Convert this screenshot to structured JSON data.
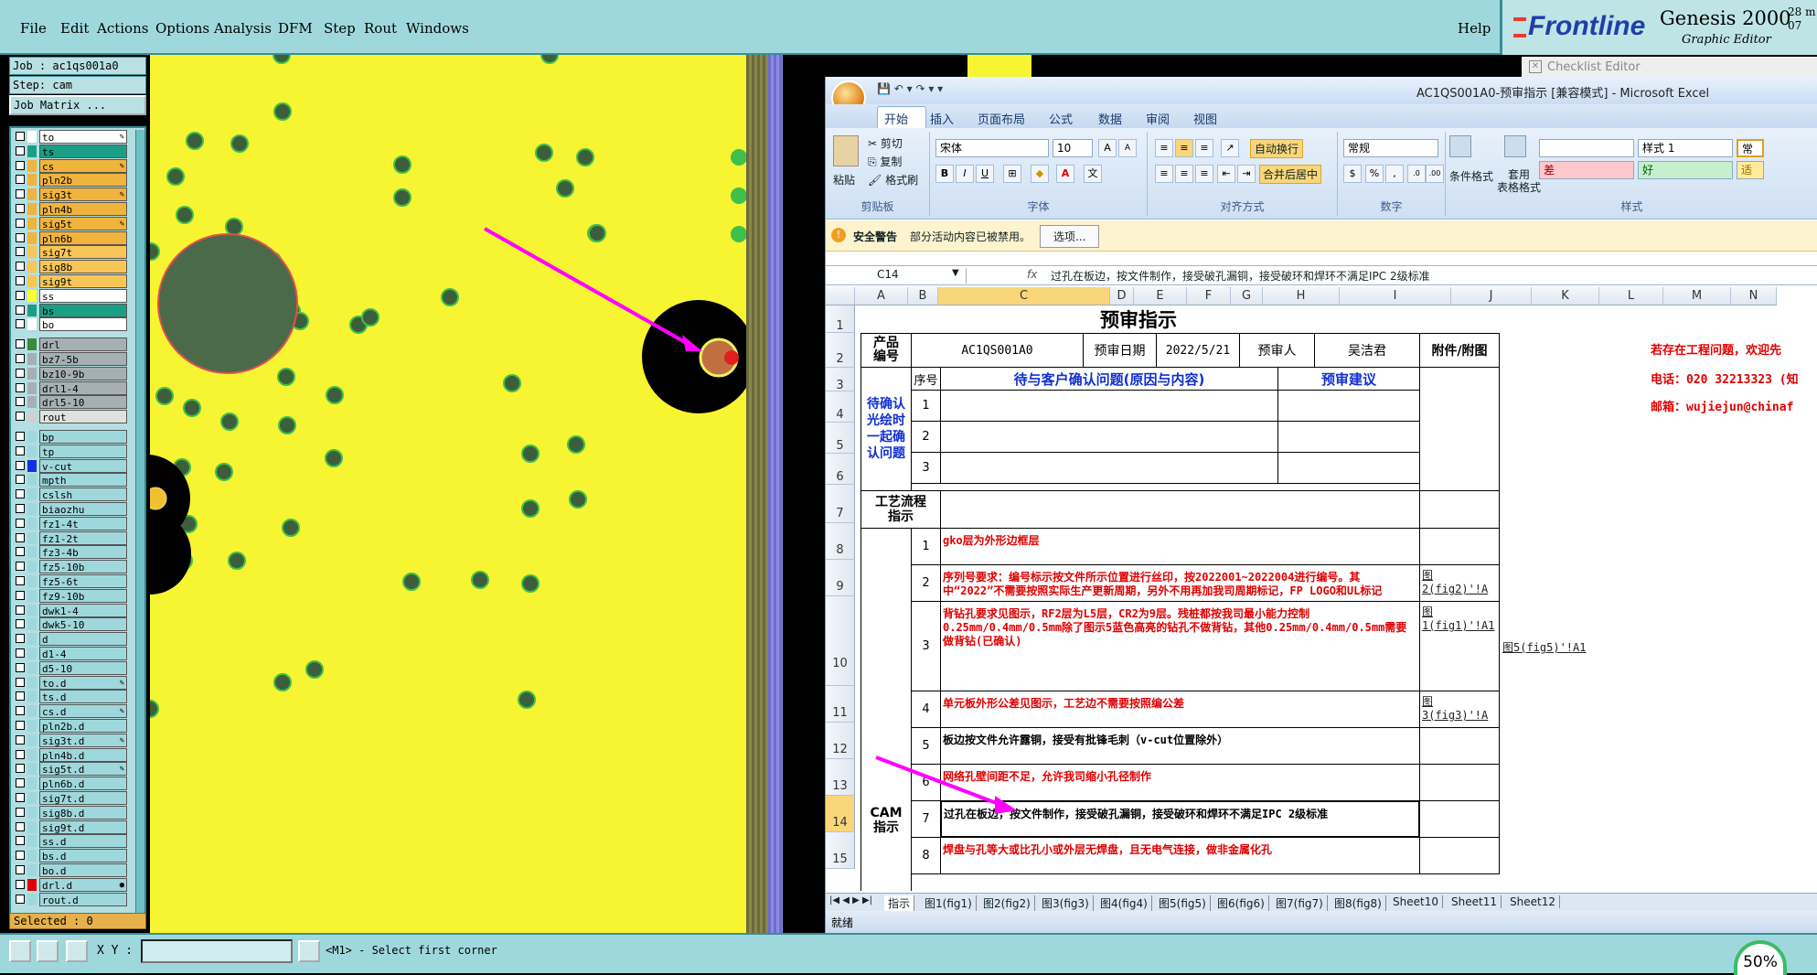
{
  "genesis": {
    "menu": [
      "File",
      "Edit",
      "Actions",
      "Options",
      "Analysis",
      "DFM",
      "Step",
      "Rout",
      "Windows"
    ],
    "help": "Help",
    "logo": "Frontline",
    "product": "Genesis 2000",
    "subtitle": "Graphic Editor",
    "date_line1": "28 m",
    "date_line2": "07",
    "job": "Job : ac1qs001a0",
    "step": "Step: cam",
    "job_matrix": "Job Matrix ...",
    "selected": "Selected : 0",
    "xy_label": "X Y :",
    "status": "<M1> - Select first corner",
    "zoom": "50%",
    "layers": [
      {
        "name": "to",
        "color": "#ffffff",
        "bg": "#ffffff",
        "pen": "✎"
      },
      {
        "name": "ts",
        "color": "#1a9f86",
        "bg": "#1a9f86",
        "pen": ""
      },
      {
        "name": "cs",
        "color": "#f0b43c",
        "bg": "#f0b43c",
        "pen": "✎"
      },
      {
        "name": "pln2b",
        "color": "#f0b43c",
        "bg": "#f0b43c",
        "pen": ""
      },
      {
        "name": "sig3t",
        "color": "#f0b43c",
        "bg": "#f0b43c",
        "pen": "✎"
      },
      {
        "name": "pln4b",
        "color": "#f0b43c",
        "bg": "#f0b43c",
        "pen": ""
      },
      {
        "name": "sig5t",
        "color": "#f0b43c",
        "bg": "#f0b43c",
        "pen": "✎"
      },
      {
        "name": "pln6b",
        "color": "#f0b43c",
        "bg": "#f0b43c",
        "pen": ""
      },
      {
        "name": "sig7t",
        "color": "#f7c657",
        "bg": "#f7c657",
        "pen": ""
      },
      {
        "name": "sig8b",
        "color": "#f7c657",
        "bg": "#f7c657",
        "pen": ""
      },
      {
        "name": "sig9t",
        "color": "#f7c657",
        "bg": "#f7c657",
        "pen": ""
      },
      {
        "name": "ss",
        "color": "#ffff33",
        "bg": "#ffffff",
        "pen": ""
      },
      {
        "name": "bs",
        "color": "#1a9f86",
        "bg": "#1a9f86",
        "pen": ""
      },
      {
        "name": "bo",
        "color": "#ffffff",
        "bg": "#ffffff",
        "pen": ""
      },
      {
        "name": "",
        "color": "#000",
        "bg": "#000",
        "pen": "",
        "gap": true
      },
      {
        "name": "drl",
        "color": "#3a8a3a",
        "bg": "#a6b0b4",
        "pen": ""
      },
      {
        "name": "bz7-5b",
        "color": "#a6b0b4",
        "bg": "#a6b0b4",
        "pen": ""
      },
      {
        "name": "bz10-9b",
        "color": "#a6b0b4",
        "bg": "#a6b0b4",
        "pen": ""
      },
      {
        "name": "drl1-4",
        "color": "#a6b0b4",
        "bg": "#a6b0b4",
        "pen": ""
      },
      {
        "name": "drl5-10",
        "color": "#a6b0b4",
        "bg": "#a6b0b4",
        "pen": ""
      },
      {
        "name": "rout",
        "color": "#d0d0d0",
        "bg": "#e0e0e0",
        "pen": ""
      },
      {
        "name": "",
        "color": "#000",
        "bg": "#000",
        "pen": "",
        "gap": true
      },
      {
        "name": "bp",
        "color": "#9fd8dc",
        "bg": "#9fd8dc",
        "pen": ""
      },
      {
        "name": "tp",
        "color": "#9fd8dc",
        "bg": "#9fd8dc",
        "pen": ""
      },
      {
        "name": "v-cut",
        "color": "#1530e0",
        "bg": "#9fd8dc",
        "pen": ""
      },
      {
        "name": "mpth",
        "color": "#9fd8dc",
        "bg": "#9fd8dc",
        "pen": ""
      },
      {
        "name": "cslsh",
        "color": "#9fd8dc",
        "bg": "#9fd8dc",
        "pen": ""
      },
      {
        "name": "biaozhu",
        "color": "#9fd8dc",
        "bg": "#9fd8dc",
        "pen": ""
      },
      {
        "name": "fz1-4t",
        "color": "#9fd8dc",
        "bg": "#9fd8dc",
        "pen": ""
      },
      {
        "name": "fz1-2t",
        "color": "#9fd8dc",
        "bg": "#9fd8dc",
        "pen": ""
      },
      {
        "name": "fz3-4b",
        "color": "#9fd8dc",
        "bg": "#9fd8dc",
        "pen": ""
      },
      {
        "name": "fz5-10b",
        "color": "#9fd8dc",
        "bg": "#9fd8dc",
        "pen": ""
      },
      {
        "name": "fz5-6t",
        "color": "#9fd8dc",
        "bg": "#9fd8dc",
        "pen": ""
      },
      {
        "name": "fz9-10b",
        "color": "#9fd8dc",
        "bg": "#9fd8dc",
        "pen": ""
      },
      {
        "name": "dwk1-4",
        "color": "#9fd8dc",
        "bg": "#9fd8dc",
        "pen": ""
      },
      {
        "name": "dwk5-10",
        "color": "#9fd8dc",
        "bg": "#9fd8dc",
        "pen": ""
      },
      {
        "name": "d",
        "color": "#9fd8dc",
        "bg": "#9fd8dc",
        "pen": ""
      },
      {
        "name": "d1-4",
        "color": "#9fd8dc",
        "bg": "#9fd8dc",
        "pen": ""
      },
      {
        "name": "d5-10",
        "color": "#9fd8dc",
        "bg": "#9fd8dc",
        "pen": ""
      },
      {
        "name": "to.d",
        "color": "#9fd8dc",
        "bg": "#9fd8dc",
        "pen": "✎"
      },
      {
        "name": "ts.d",
        "color": "#9fd8dc",
        "bg": "#9fd8dc",
        "pen": ""
      },
      {
        "name": "cs.d",
        "color": "#9fd8dc",
        "bg": "#9fd8dc",
        "pen": "✎"
      },
      {
        "name": "pln2b.d",
        "color": "#9fd8dc",
        "bg": "#9fd8dc",
        "pen": ""
      },
      {
        "name": "sig3t.d",
        "color": "#9fd8dc",
        "bg": "#9fd8dc",
        "pen": "✎"
      },
      {
        "name": "pln4b.d",
        "color": "#9fd8dc",
        "bg": "#9fd8dc",
        "pen": ""
      },
      {
        "name": "sig5t.d",
        "color": "#9fd8dc",
        "bg": "#9fd8dc",
        "pen": "✎"
      },
      {
        "name": "pln6b.d",
        "color": "#9fd8dc",
        "bg": "#9fd8dc",
        "pen": ""
      },
      {
        "name": "sig7t.d",
        "color": "#9fd8dc",
        "bg": "#9fd8dc",
        "pen": ""
      },
      {
        "name": "sig8b.d",
        "color": "#9fd8dc",
        "bg": "#9fd8dc",
        "pen": ""
      },
      {
        "name": "sig9t.d",
        "color": "#9fd8dc",
        "bg": "#9fd8dc",
        "pen": ""
      },
      {
        "name": "ss.d",
        "color": "#9fd8dc",
        "bg": "#9fd8dc",
        "pen": ""
      },
      {
        "name": "bs.d",
        "color": "#9fd8dc",
        "bg": "#9fd8dc",
        "pen": ""
      },
      {
        "name": "bo.d",
        "color": "#9fd8dc",
        "bg": "#9fd8dc",
        "pen": ""
      },
      {
        "name": "drl.d",
        "color": "#e00000",
        "bg": "#9fd8dc",
        "pen": "●"
      },
      {
        "name": "rout.d",
        "color": "#9fd8dc",
        "bg": "#9fd8dc",
        "pen": ""
      }
    ]
  },
  "checklist": "Checklist Editor",
  "excel": {
    "title": "AC1QS001A0-预审指示  [兼容模式] - Microsoft Excel",
    "tabs": [
      "开始",
      "插入",
      "页面布局",
      "公式",
      "数据",
      "审阅",
      "视图"
    ],
    "ribbon": {
      "paste": "粘贴",
      "cut": "剪切",
      "copy": "复制",
      "format_painter": "格式刷",
      "clipboard": "剪贴板",
      "font_name": "宋体",
      "font_size": "10",
      "font": "字体",
      "wrap": "自动换行",
      "merge": "合并后居中",
      "alignment": "对齐方式",
      "number_format": "常规",
      "number": "数字",
      "cond_format": "条件格式",
      "table_format": "套用\n表格格式",
      "style1": "样式 1",
      "normal": "常",
      "bad": "差",
      "good": "好",
      "neutral": "适",
      "styles": "样式"
    },
    "security_label": "安全警告",
    "security_text": "部分活动内容已被禁用。",
    "security_button": "选项...",
    "name_box": "C14",
    "fx": "fx",
    "formula": "过孔在板边，按文件制作，接受破孔漏铜，接受破环和焊环不满足IPC 2级标准",
    "columns": [
      "A",
      "B",
      "C",
      "D",
      "E",
      "F",
      "G",
      "H",
      "I",
      "J",
      "K",
      "L",
      "M",
      "N"
    ],
    "rows": [
      "1",
      "2",
      "3",
      "4",
      "5",
      "6",
      "7",
      "8",
      "9",
      "10",
      "11",
      "12",
      "13",
      "14",
      "15"
    ],
    "sheet": {
      "title": "预审指示",
      "product_no_label": "产品\n编号",
      "product_no": "AC1QS001A0",
      "review_date_label": "预审日期",
      "review_date": "2022/5/21",
      "reviewer_label": "预审人",
      "reviewer": "吴洁君",
      "attach_label": "附件/附图",
      "contact1": "若存在工程问题，欢迎先",
      "contact2": "电话：020 32213323 (知",
      "contact3": "邮箱：wujiejun@chinaf",
      "seq_label": "序号",
      "question_header": "待与客户确认问题(原因与内容)",
      "suggest_header": "预审建议",
      "pending_label": "待确认\n光绘时\n一起确\n认问题",
      "pending_rows": [
        "1",
        "2",
        "3"
      ],
      "process_label": "工艺流程\n指示",
      "cam_label": "CAM\n指示",
      "instructions": [
        {
          "n": "1",
          "text": "gko层为外形边框层",
          "color": "red",
          "attach": ""
        },
        {
          "n": "2",
          "text": "序列号要求：编号标示按文件所示位置进行丝印，按2022001~2022004进行编号。其中“2022”不需要按照实际生产更新周期，另外不用再加我司周期标记，FP LOGO和UL标记",
          "color": "red",
          "attach": "图2(fig2)'!A"
        },
        {
          "n": "3",
          "text": "背钻孔要求见图示，RF2层为L5层，CR2为9层。残桩都按我司最小能力控制 0.25mm/0.4mm/0.5mm除了图示5蓝色高亮的钻孔不做背钻，其他0.25mm/0.4mm/0.5mm需要做背钻(已确认)",
          "color": "red",
          "attach": "图1(fig1)'!A1",
          "attach2": "图5(fig5)'!A1"
        },
        {
          "n": "4",
          "text": "单元板外形公差见图示，工艺边不需要按照编公差",
          "color": "red",
          "attach": "图3(fig3)'!A"
        },
        {
          "n": "5",
          "text": "板边按文件允许露铜，接受有批锋毛刺（v-cut位置除外）",
          "color": "blk",
          "attach": ""
        },
        {
          "n": "6",
          "text": "网络孔壁间距不足，允许我司缩小孔径制作",
          "color": "red",
          "attach": ""
        },
        {
          "n": "7",
          "text": "过孔在板边，按文件制作，接受破孔漏铜，接受破环和焊环不满足IPC 2级标准",
          "color": "blk",
          "attach": ""
        },
        {
          "n": "8",
          "text": "焊盘与孔等大或比孔小或外层无焊盘，且无电气连接，做非金属化孔",
          "color": "red",
          "attach": ""
        }
      ]
    },
    "sheet_tabs": [
      "指示",
      "图1(fig1)",
      "图2(fig2)",
      "图3(fig3)",
      "图4(fig4)",
      "图5(fig5)",
      "图6(fig6)",
      "图7(fig7)",
      "图8(fig8)",
      "Sheet10",
      "Sheet11",
      "Sheet12"
    ],
    "status": "就绪"
  }
}
